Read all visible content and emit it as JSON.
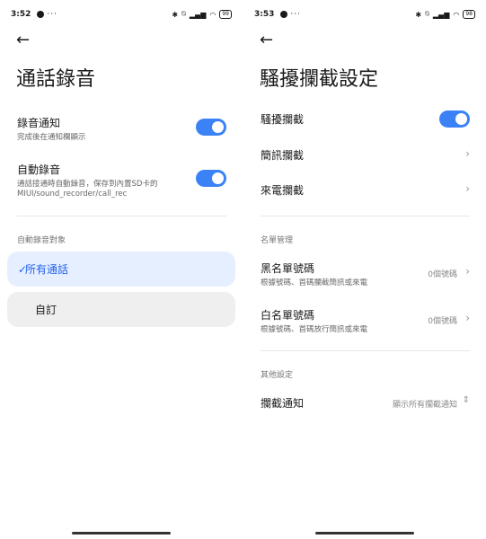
{
  "left": {
    "status": {
      "time": "3:52",
      "dots": "···",
      "battery": "99"
    },
    "title": "通話錄音",
    "settings": [
      {
        "label": "錄音通知",
        "sub": "完成後在通知欄顯示",
        "on": true
      },
      {
        "label": "自動錄音",
        "sub": "通話接通時自動錄音，保存到內置SD卡的MIUI/sound_recorder/call_rec",
        "on": true
      }
    ],
    "section": "自動錄音對象",
    "options": [
      {
        "label": "所有通話",
        "selected": true
      },
      {
        "label": "自訂",
        "selected": false
      }
    ]
  },
  "right": {
    "status": {
      "time": "3:53",
      "dots": "···",
      "battery": "98"
    },
    "title": "騷擾攔截設定",
    "items": {
      "harass": "騷擾攔截",
      "sms": "簡訊攔截",
      "call": "來電攔截"
    },
    "section_list": "名單管理",
    "blacklist": {
      "label": "黑名單號碼",
      "sub": "根據號碼、首碼攔截簡訊或來電",
      "value": "0個號碼"
    },
    "whitelist": {
      "label": "白名單號碼",
      "sub": "根據號碼、首碼放行簡訊或來電",
      "value": "0個號碼"
    },
    "section_other": "其他設定",
    "notify": {
      "label": "攔截通知",
      "value": "顯示所有攔截通知"
    }
  },
  "colors": {
    "accent": "#3b82f6",
    "selected_bg": "#e6efff"
  },
  "icons": {
    "back": "arrow-left-icon",
    "chevron": "chevron-right-icon",
    "check": "check-icon",
    "updown": "chevron-updown-icon"
  }
}
